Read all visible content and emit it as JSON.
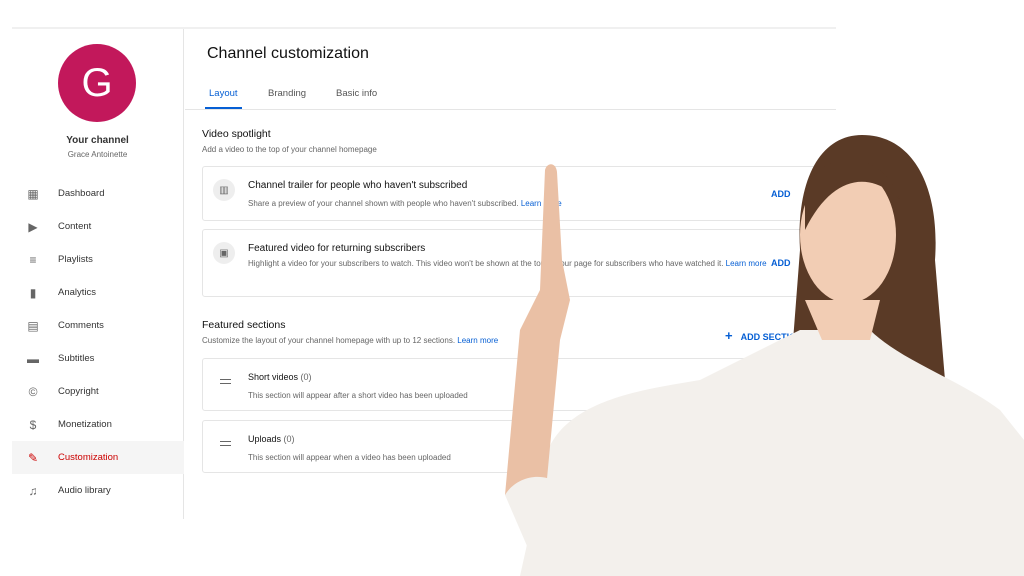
{
  "channel": {
    "initial": "G",
    "label": "Your channel",
    "name": "Grace Antoinette",
    "avatar_color": "#c2185b"
  },
  "sidebar": {
    "items": [
      {
        "label": "Dashboard",
        "icon": "dashboard-icon",
        "glyph": "▦"
      },
      {
        "label": "Content",
        "icon": "content-icon",
        "glyph": "▶"
      },
      {
        "label": "Playlists",
        "icon": "playlists-icon",
        "glyph": "≡"
      },
      {
        "label": "Analytics",
        "icon": "analytics-icon",
        "glyph": "▮"
      },
      {
        "label": "Comments",
        "icon": "comments-icon",
        "glyph": "▤"
      },
      {
        "label": "Subtitles",
        "icon": "subtitles-icon",
        "glyph": "▬"
      },
      {
        "label": "Copyright",
        "icon": "copyright-icon",
        "glyph": "©"
      },
      {
        "label": "Monetization",
        "icon": "monetization-icon",
        "glyph": "$"
      },
      {
        "label": "Customization",
        "icon": "customization-icon",
        "glyph": "✎",
        "active": true
      },
      {
        "label": "Audio library",
        "icon": "audio-library-icon",
        "glyph": "♫"
      }
    ]
  },
  "page": {
    "title": "Channel customization",
    "tabs": [
      "Layout",
      "Branding",
      "Basic info"
    ],
    "active_tab": "Layout"
  },
  "spotlight": {
    "title": "Video spotlight",
    "subtitle": "Add a video to the top of your channel homepage",
    "cards": [
      {
        "title": "Channel trailer for people who haven't subscribed",
        "desc": "Share a preview of your channel shown with people who haven't subscribed.",
        "link": "Learn more",
        "action": "ADD"
      },
      {
        "title": "Featured video for returning subscribers",
        "desc": "Highlight a video for your subscribers to watch. This video won't be shown at the top of your page for subscribers who have watched it.",
        "link": "Learn more",
        "action": "ADD"
      }
    ]
  },
  "featured": {
    "title": "Featured sections",
    "subtitle": "Customize the layout of your channel homepage with up to 12 sections.",
    "link": "Learn more",
    "action": "ADD SECTION",
    "sections": [
      {
        "title": "Short videos",
        "count": "(0)",
        "desc": "This section will appear after a short video has been uploaded"
      },
      {
        "title": "Uploads",
        "count": "(0)",
        "desc": "This section will appear when a video has been uploaded"
      }
    ]
  },
  "colors": {
    "accent": "#065fd4",
    "active_nav": "#cc0000"
  }
}
